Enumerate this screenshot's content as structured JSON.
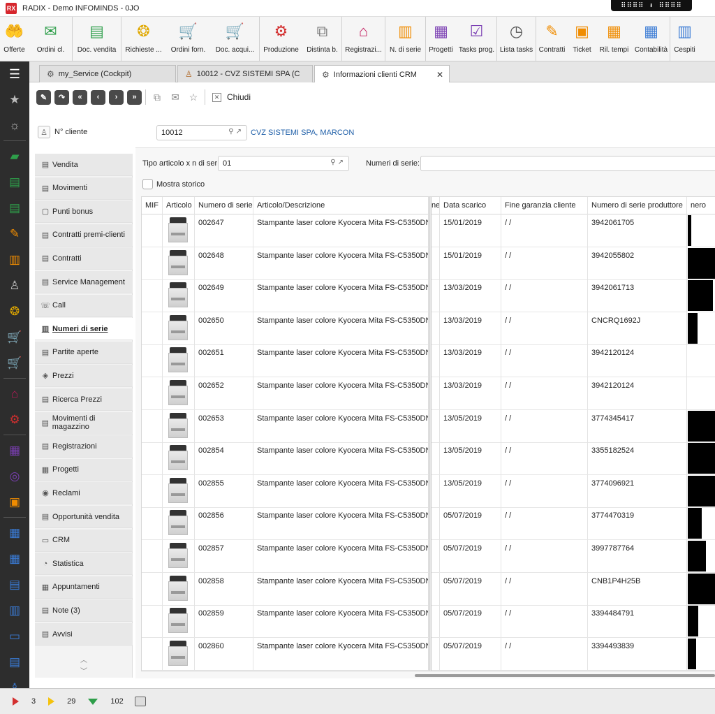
{
  "window": {
    "title": "RADIX - Demo INFOMINDS - 0JO",
    "logo": "RX",
    "dragbar": "⠿⠿⠿⠿ ⬇ ⠿⠿⠿⠿"
  },
  "ribbon": [
    {
      "label": "Offerte",
      "icon": "hand-money-icon",
      "glyph": "🤲",
      "color": "#2e9e4a"
    },
    {
      "label": "Ordini cl.",
      "icon": "order-envelope-icon",
      "glyph": "✉",
      "color": "#2e9e4a"
    },
    {
      "label": "Doc. vendita",
      "icon": "sales-doc-icon",
      "glyph": "▤",
      "color": "#2e9e4a"
    },
    {
      "label": "Richieste ...",
      "icon": "requests-coins-icon",
      "glyph": "❂",
      "color": "#e0a800"
    },
    {
      "label": "Ordini forn.",
      "icon": "supplier-cart-icon",
      "glyph": "🛒",
      "color": "#e0a800"
    },
    {
      "label": "Doc. acqui...",
      "icon": "purchase-cart-icon",
      "glyph": "🛒",
      "color": "#e0a800"
    },
    {
      "label": "Produzione",
      "icon": "production-gear-icon",
      "glyph": "⚙",
      "color": "#d32f2f"
    },
    {
      "label": "Distinta b.",
      "icon": "bill-of-materials-icon",
      "glyph": "⧉",
      "color": "#777"
    },
    {
      "label": "Registrazi...",
      "icon": "warehouse-icon",
      "glyph": "⌂",
      "color": "#c2185b"
    },
    {
      "label": "N. di serie",
      "icon": "barcode-icon",
      "glyph": "▥",
      "color": "#f08c00"
    },
    {
      "label": "Progetti",
      "icon": "projects-icon",
      "glyph": "▦",
      "color": "#7b3fb3"
    },
    {
      "label": "Tasks prog.",
      "icon": "tasks-icon",
      "glyph": "☑",
      "color": "#7b3fb3"
    },
    {
      "label": "Lista tasks",
      "icon": "task-list-clock-icon",
      "glyph": "◷",
      "color": "#555"
    },
    {
      "label": "Contratti",
      "icon": "contracts-icon",
      "glyph": "✎",
      "color": "#f08c00"
    },
    {
      "label": "Ticket",
      "icon": "ticket-briefcase-icon",
      "glyph": "▣",
      "color": "#f08c00"
    },
    {
      "label": "Ril. tempi",
      "icon": "time-tracking-icon",
      "glyph": "▦",
      "color": "#f08c00"
    },
    {
      "label": "Contabilità",
      "icon": "accounting-calculator-icon",
      "glyph": "▦",
      "color": "#3a7bd5"
    },
    {
      "label": "Cespiti",
      "icon": "assets-building-icon",
      "glyph": "▥",
      "color": "#3a7bd5"
    }
  ],
  "leftnav": [
    {
      "icon": "star-icon",
      "glyph": "★",
      "color": "#bbb"
    },
    {
      "icon": "sun-icon",
      "glyph": "☼",
      "color": "#bbb"
    },
    {
      "icon": "hand-money-icon",
      "glyph": "▰",
      "color": "#2e9e4a"
    },
    {
      "icon": "order-envelope-icon",
      "glyph": "▤",
      "color": "#2e9e4a"
    },
    {
      "icon": "sales-doc-icon",
      "glyph": "▤",
      "color": "#2e9e4a"
    },
    {
      "icon": "contracts-icon",
      "glyph": "✎",
      "color": "#f08c00"
    },
    {
      "icon": "barcode-icon",
      "glyph": "▥",
      "color": "#f08c00"
    },
    {
      "icon": "user-icon",
      "glyph": "♙",
      "color": "#bbb"
    },
    {
      "icon": "coins-icon",
      "glyph": "❂",
      "color": "#e0a800"
    },
    {
      "icon": "cart-icon",
      "glyph": "🛒",
      "color": "#e0a800"
    },
    {
      "icon": "cart-icon",
      "glyph": "🛒",
      "color": "#e0a800"
    },
    {
      "icon": "warehouse-icon",
      "glyph": "⌂",
      "color": "#c2185b"
    },
    {
      "icon": "gear-icon",
      "glyph": "⚙",
      "color": "#d32f2f"
    },
    {
      "icon": "projects-icon",
      "glyph": "▦",
      "color": "#7b3fb3"
    },
    {
      "icon": "target-icon",
      "glyph": "◎",
      "color": "#7b3fb3"
    },
    {
      "icon": "briefcase-icon",
      "glyph": "▣",
      "color": "#f08c00"
    },
    {
      "icon": "calculator-icon",
      "glyph": "▦",
      "color": "#3a7bd5"
    },
    {
      "icon": "calculator-icon",
      "glyph": "▦",
      "color": "#3a7bd5"
    },
    {
      "icon": "document-icon",
      "glyph": "▤",
      "color": "#3a7bd5"
    },
    {
      "icon": "building-icon",
      "glyph": "▥",
      "color": "#3a7bd5"
    },
    {
      "icon": "card-icon",
      "glyph": "▭",
      "color": "#3a7bd5"
    },
    {
      "icon": "document-icon",
      "glyph": "▤",
      "color": "#3a7bd5"
    },
    {
      "icon": "user-settings-icon",
      "glyph": "♙",
      "color": "#3a7bd5"
    }
  ],
  "tabs": [
    {
      "label": "my_Service (Cockpit)",
      "icon": "gear-icon",
      "glyph": "⚙"
    },
    {
      "label": "10012 - CVZ SISTEMI SPA (C",
      "icon": "user-icon",
      "glyph": "♙"
    },
    {
      "label": "Informazioni clienti CRM",
      "icon": "gear-icon",
      "glyph": "⚙",
      "close": "✕"
    }
  ],
  "toolbar": {
    "close_label": "Chiudi"
  },
  "customer": {
    "label": "N° cliente",
    "value": "10012",
    "name": "CVZ SISTEMI SPA, MARCON"
  },
  "sidemenu": [
    {
      "label": "Vendita",
      "icon": "sales-icon",
      "glyph": "▤"
    },
    {
      "label": "Movimenti",
      "icon": "movements-icon",
      "glyph": "▤"
    },
    {
      "label": "Punti bonus",
      "icon": "bonus-points-icon",
      "glyph": "▢"
    },
    {
      "label": "Contratti premi-clienti",
      "icon": "contract-icon",
      "glyph": "▤"
    },
    {
      "label": "Contratti",
      "icon": "contract-icon",
      "glyph": "▤"
    },
    {
      "label": "Service Management",
      "icon": "service-icon",
      "glyph": "▤"
    },
    {
      "label": "Call",
      "icon": "phone-icon",
      "glyph": "☏"
    },
    {
      "label": "Numeri di serie",
      "icon": "barcode-icon",
      "glyph": "▥",
      "active": true
    },
    {
      "label": "Partite aperte",
      "icon": "open-items-icon",
      "glyph": "▤"
    },
    {
      "label": "Prezzi",
      "icon": "price-tag-icon",
      "glyph": "◈"
    },
    {
      "label": "Ricerca Prezzi",
      "icon": "price-search-icon",
      "glyph": "▤"
    },
    {
      "label": "Movimenti di magazzino",
      "icon": "warehouse-movements-icon",
      "glyph": "▤"
    },
    {
      "label": "Registrazioni",
      "icon": "registrations-icon",
      "glyph": "▤"
    },
    {
      "label": "Progetti",
      "icon": "projects-icon",
      "glyph": "▦"
    },
    {
      "label": "Reclami",
      "icon": "complaint-icon",
      "glyph": "◉"
    },
    {
      "label": "Opportunità vendita",
      "icon": "opportunity-icon",
      "glyph": "▤"
    },
    {
      "label": "CRM",
      "icon": "crm-icon",
      "glyph": "▭"
    },
    {
      "label": "Statistica",
      "icon": "statistics-icon",
      "glyph": "◔"
    },
    {
      "label": "Appuntamenti",
      "icon": "calendar-icon",
      "glyph": "▦"
    },
    {
      "label": "Note (3)",
      "icon": "note-icon",
      "glyph": "▤"
    },
    {
      "label": "Avvisi",
      "icon": "alert-icon",
      "glyph": "▤"
    }
  ],
  "filters": {
    "tipo_label": "Tipo articolo x n di seri",
    "tipo_value": "01",
    "numeri_label": "Numeri di serie:",
    "numeri_value": "",
    "storico_label": "Mostra storico"
  },
  "grid": {
    "columns": {
      "mif": "MIF",
      "articolo": "Articolo",
      "numero": "Numero di serie",
      "descr": "Articolo/Descrizione",
      "hidden": "ne",
      "data": "Data scarico",
      "garanzia": "Fine garanzia cliente",
      "produttore": "Numero di serie produttore",
      "nero": "nero"
    },
    "rows": [
      {
        "numero": "002647",
        "descr": "Stampante laser colore Kyocera Mita FS-C5350DN",
        "data": "15/01/2019",
        "garanzia": " /  /",
        "produttore": "3942061705",
        "nero_level": 0.1
      },
      {
        "numero": "002648",
        "descr": "Stampante laser colore Kyocera Mita FS-C5350DN",
        "data": "15/01/2019",
        "garanzia": " /  /",
        "produttore": "3942055802",
        "nero_level": 0.95
      },
      {
        "numero": "002649",
        "descr": "Stampante laser colore Kyocera Mita FS-C5350DN",
        "data": "13/03/2019",
        "garanzia": " /  /",
        "produttore": "3942061713",
        "nero_level": 0.75
      },
      {
        "numero": "002650",
        "descr": "Stampante laser colore Kyocera Mita FS-C5350DN",
        "data": "13/03/2019",
        "garanzia": " /  /",
        "produttore": "CNCRQ1692J",
        "nero_level": 0.3
      },
      {
        "numero": "002651",
        "descr": "Stampante laser colore Kyocera Mita FS-C5350DN",
        "data": "13/03/2019",
        "garanzia": " /  /",
        "produttore": "3942120124",
        "nero_level": 0
      },
      {
        "numero": "002652",
        "descr": "Stampante laser colore Kyocera Mita FS-C5350DN",
        "data": "13/03/2019",
        "garanzia": " /  /",
        "produttore": "3942120124",
        "nero_level": 0
      },
      {
        "numero": "002653",
        "descr": "Stampante laser colore Kyocera Mita FS-C5350DN",
        "data": "13/05/2019",
        "garanzia": " /  /",
        "produttore": "3774345417",
        "nero_level": 1
      },
      {
        "numero": "002854",
        "descr": "Stampante laser colore Kyocera Mita FS-C5350DN",
        "data": "13/05/2019",
        "garanzia": " /  /",
        "produttore": "3355182524",
        "nero_level": 1
      },
      {
        "numero": "002855",
        "descr": "Stampante laser colore Kyocera Mita FS-C5350DN",
        "data": "13/05/2019",
        "garanzia": " /  /",
        "produttore": "3774096921",
        "nero_level": 0.98
      },
      {
        "numero": "002856",
        "descr": "Stampante laser colore Kyocera Mita FS-C5350DN",
        "data": "05/07/2019",
        "garanzia": " /  /",
        "produttore": "3774470319",
        "nero_level": 0.42
      },
      {
        "numero": "002857",
        "descr": "Stampante laser colore Kyocera Mita FS-C5350DN",
        "data": "05/07/2019",
        "garanzia": " /  /",
        "produttore": "3997787764",
        "nero_level": 0.55
      },
      {
        "numero": "002858",
        "descr": "Stampante laser colore Kyocera Mita FS-C5350DN",
        "data": "05/07/2019",
        "garanzia": " /  /",
        "produttore": "CNB1P4H25B",
        "nero_level": 0.95
      },
      {
        "numero": "002859",
        "descr": "Stampante laser colore Kyocera Mita FS-C5350DN",
        "data": "05/07/2019",
        "garanzia": " /  /",
        "produttore": "3394484791",
        "nero_level": 0.32
      },
      {
        "numero": "002860",
        "descr": "Stampante laser colore Kyocera Mita FS-C5350DN",
        "data": "05/07/2019",
        "garanzia": " /  /",
        "produttore": "3394493839",
        "nero_level": 0.26
      }
    ]
  },
  "status": {
    "red_count": "3",
    "yellow_count": "29",
    "green_count": "102"
  }
}
